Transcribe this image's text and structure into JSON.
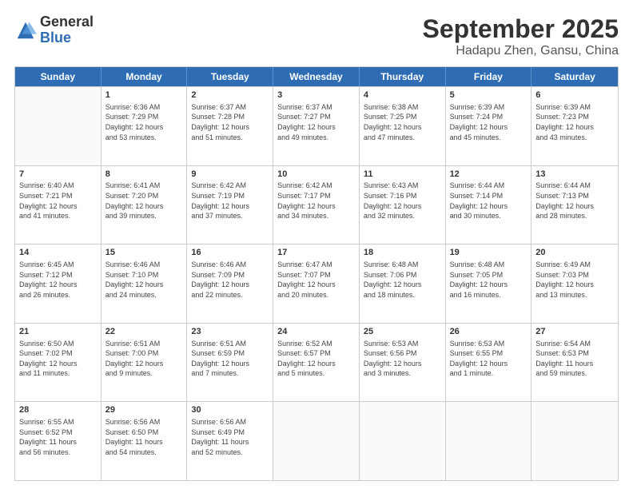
{
  "logo": {
    "general": "General",
    "blue": "Blue"
  },
  "header": {
    "month": "September 2025",
    "location": "Hadapu Zhen, Gansu, China"
  },
  "weekdays": [
    "Sunday",
    "Monday",
    "Tuesday",
    "Wednesday",
    "Thursday",
    "Friday",
    "Saturday"
  ],
  "weeks": [
    [
      {
        "day": "",
        "info": ""
      },
      {
        "day": "1",
        "info": "Sunrise: 6:36 AM\nSunset: 7:29 PM\nDaylight: 12 hours\nand 53 minutes."
      },
      {
        "day": "2",
        "info": "Sunrise: 6:37 AM\nSunset: 7:28 PM\nDaylight: 12 hours\nand 51 minutes."
      },
      {
        "day": "3",
        "info": "Sunrise: 6:37 AM\nSunset: 7:27 PM\nDaylight: 12 hours\nand 49 minutes."
      },
      {
        "day": "4",
        "info": "Sunrise: 6:38 AM\nSunset: 7:25 PM\nDaylight: 12 hours\nand 47 minutes."
      },
      {
        "day": "5",
        "info": "Sunrise: 6:39 AM\nSunset: 7:24 PM\nDaylight: 12 hours\nand 45 minutes."
      },
      {
        "day": "6",
        "info": "Sunrise: 6:39 AM\nSunset: 7:23 PM\nDaylight: 12 hours\nand 43 minutes."
      }
    ],
    [
      {
        "day": "7",
        "info": "Sunrise: 6:40 AM\nSunset: 7:21 PM\nDaylight: 12 hours\nand 41 minutes."
      },
      {
        "day": "8",
        "info": "Sunrise: 6:41 AM\nSunset: 7:20 PM\nDaylight: 12 hours\nand 39 minutes."
      },
      {
        "day": "9",
        "info": "Sunrise: 6:42 AM\nSunset: 7:19 PM\nDaylight: 12 hours\nand 37 minutes."
      },
      {
        "day": "10",
        "info": "Sunrise: 6:42 AM\nSunset: 7:17 PM\nDaylight: 12 hours\nand 34 minutes."
      },
      {
        "day": "11",
        "info": "Sunrise: 6:43 AM\nSunset: 7:16 PM\nDaylight: 12 hours\nand 32 minutes."
      },
      {
        "day": "12",
        "info": "Sunrise: 6:44 AM\nSunset: 7:14 PM\nDaylight: 12 hours\nand 30 minutes."
      },
      {
        "day": "13",
        "info": "Sunrise: 6:44 AM\nSunset: 7:13 PM\nDaylight: 12 hours\nand 28 minutes."
      }
    ],
    [
      {
        "day": "14",
        "info": "Sunrise: 6:45 AM\nSunset: 7:12 PM\nDaylight: 12 hours\nand 26 minutes."
      },
      {
        "day": "15",
        "info": "Sunrise: 6:46 AM\nSunset: 7:10 PM\nDaylight: 12 hours\nand 24 minutes."
      },
      {
        "day": "16",
        "info": "Sunrise: 6:46 AM\nSunset: 7:09 PM\nDaylight: 12 hours\nand 22 minutes."
      },
      {
        "day": "17",
        "info": "Sunrise: 6:47 AM\nSunset: 7:07 PM\nDaylight: 12 hours\nand 20 minutes."
      },
      {
        "day": "18",
        "info": "Sunrise: 6:48 AM\nSunset: 7:06 PM\nDaylight: 12 hours\nand 18 minutes."
      },
      {
        "day": "19",
        "info": "Sunrise: 6:48 AM\nSunset: 7:05 PM\nDaylight: 12 hours\nand 16 minutes."
      },
      {
        "day": "20",
        "info": "Sunrise: 6:49 AM\nSunset: 7:03 PM\nDaylight: 12 hours\nand 13 minutes."
      }
    ],
    [
      {
        "day": "21",
        "info": "Sunrise: 6:50 AM\nSunset: 7:02 PM\nDaylight: 12 hours\nand 11 minutes."
      },
      {
        "day": "22",
        "info": "Sunrise: 6:51 AM\nSunset: 7:00 PM\nDaylight: 12 hours\nand 9 minutes."
      },
      {
        "day": "23",
        "info": "Sunrise: 6:51 AM\nSunset: 6:59 PM\nDaylight: 12 hours\nand 7 minutes."
      },
      {
        "day": "24",
        "info": "Sunrise: 6:52 AM\nSunset: 6:57 PM\nDaylight: 12 hours\nand 5 minutes."
      },
      {
        "day": "25",
        "info": "Sunrise: 6:53 AM\nSunset: 6:56 PM\nDaylight: 12 hours\nand 3 minutes."
      },
      {
        "day": "26",
        "info": "Sunrise: 6:53 AM\nSunset: 6:55 PM\nDaylight: 12 hours\nand 1 minute."
      },
      {
        "day": "27",
        "info": "Sunrise: 6:54 AM\nSunset: 6:53 PM\nDaylight: 11 hours\nand 59 minutes."
      }
    ],
    [
      {
        "day": "28",
        "info": "Sunrise: 6:55 AM\nSunset: 6:52 PM\nDaylight: 11 hours\nand 56 minutes."
      },
      {
        "day": "29",
        "info": "Sunrise: 6:56 AM\nSunset: 6:50 PM\nDaylight: 11 hours\nand 54 minutes."
      },
      {
        "day": "30",
        "info": "Sunrise: 6:56 AM\nSunset: 6:49 PM\nDaylight: 11 hours\nand 52 minutes."
      },
      {
        "day": "",
        "info": ""
      },
      {
        "day": "",
        "info": ""
      },
      {
        "day": "",
        "info": ""
      },
      {
        "day": "",
        "info": ""
      }
    ]
  ]
}
